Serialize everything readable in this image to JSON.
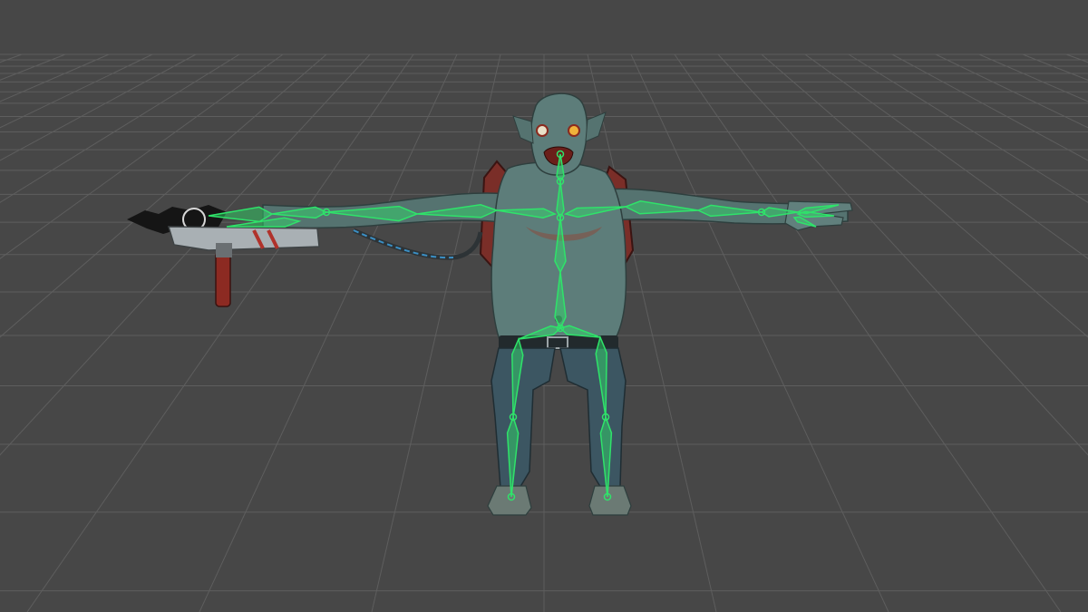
{
  "viewport": {
    "background_color": "#474747",
    "grid_color": "#5e5e5e",
    "grid_visible": true
  },
  "character": {
    "pose": "T-pose",
    "skin_color": "#5d7d7a",
    "pants_color": "#3c5662",
    "strap_color": "#7a2e28"
  },
  "weapon": {
    "kind": "saw-icon"
  },
  "skeleton": {
    "bone_color": "#2fe36a",
    "bone_fill_opacity": 0.45,
    "visible": true
  }
}
